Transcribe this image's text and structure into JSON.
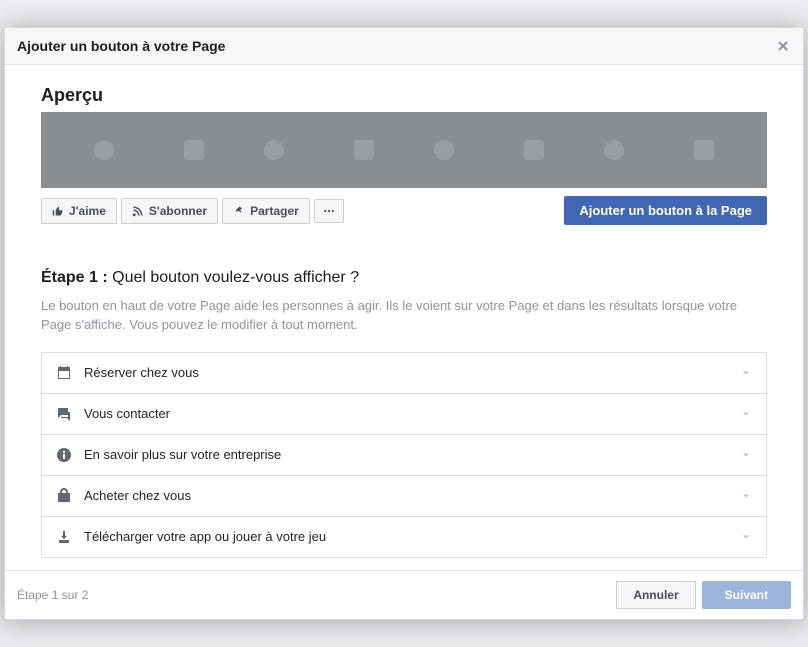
{
  "header": {
    "title": "Ajouter un bouton à votre Page"
  },
  "preview": {
    "label": "Aperçu",
    "like": "J'aime",
    "follow": "S'abonner",
    "share": "Partager",
    "cta": "Ajouter un bouton à la Page"
  },
  "step": {
    "prefix": "Étape 1 :",
    "question": " Quel bouton voulez-vous afficher ?",
    "description": "Le bouton en haut de votre Page aide les personnes à agir. Ils le voient sur votre Page et dans les résultats lorsque votre Page s'affiche. Vous pouvez le modifier à tout moment."
  },
  "options": {
    "book": "Réserver chez vous",
    "contact": "Vous contacter",
    "learn": "En savoir plus sur votre entreprise",
    "shop": "Acheter chez vous",
    "download": "Télécharger votre app ou jouer à votre jeu"
  },
  "footer": {
    "progress": "Étape 1 sur 2",
    "cancel": "Annuler",
    "next": "Suivant"
  }
}
